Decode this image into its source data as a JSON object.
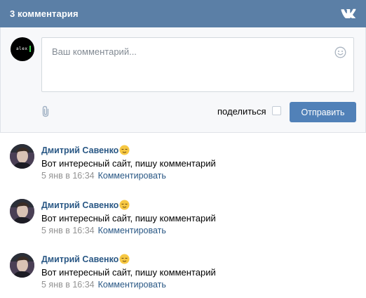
{
  "header": {
    "title": "3 комментария",
    "logo_icon": "vk-logo-icon"
  },
  "compose": {
    "avatar_text": "alex",
    "placeholder": "Ваш комментарий...",
    "value": "",
    "smile_icon": "smile-icon",
    "attach_icon": "paperclip-icon",
    "share_label": "поделиться",
    "share_checked": false,
    "send_label": "Отправить"
  },
  "comments": [
    {
      "author": "Дмитрий Савенко",
      "emoji": "relieved-face-emoji",
      "text": "Вот интересный сайт, пишу комментарий",
      "date": "5 янв в 16:34",
      "reply_label": "Комментировать"
    },
    {
      "author": "Дмитрий Савенко",
      "emoji": "relieved-face-emoji",
      "text": "Вот интересный сайт, пишу комментарий",
      "date": "5 янв в 16:34",
      "reply_label": "Комментировать"
    },
    {
      "author": "Дмитрий Савенко",
      "emoji": "relieved-face-emoji",
      "text": "Вот интересный сайт, пишу комментарий",
      "date": "5 янв в 16:34",
      "reply_label": "Комментировать"
    }
  ],
  "colors": {
    "header_bg": "#5b7fa6",
    "button_bg": "#5181b8",
    "link": "#2a5885",
    "muted": "#939393"
  }
}
